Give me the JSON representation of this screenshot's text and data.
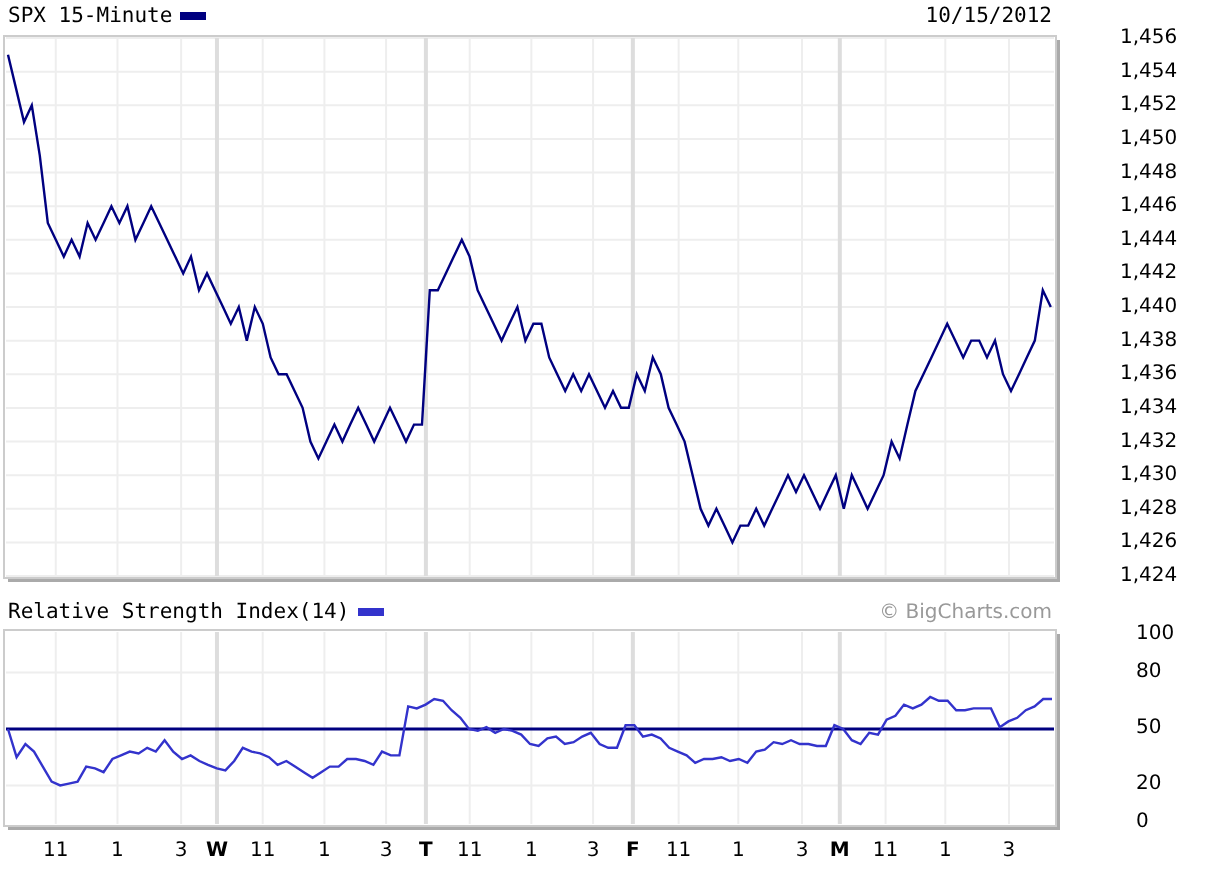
{
  "price_panel": {
    "date": "10/15/2012",
    "chart_data": {
      "type": "line",
      "grid": true,
      "series": [
        {
          "name": "SPX 15-Minute",
          "color": "#000080",
          "values": [
            1455,
            1453,
            1451,
            1452,
            1449,
            1445,
            1444,
            1443,
            1444,
            1443,
            1445,
            1444,
            1445,
            1446,
            1445,
            1446,
            1444,
            1445,
            1446,
            1445,
            1444,
            1443,
            1442,
            1443,
            1441,
            1442,
            1441,
            1440,
            1439,
            1440,
            1438,
            1440,
            1439,
            1437,
            1436,
            1436,
            1435,
            1434,
            1432,
            1431,
            1432,
            1433,
            1432,
            1433,
            1434,
            1433,
            1432,
            1433,
            1434,
            1433,
            1432,
            1433,
            1433,
            1441,
            1441,
            1442,
            1443,
            1444,
            1443,
            1441,
            1440,
            1439,
            1438,
            1439,
            1440,
            1438,
            1439,
            1439,
            1437,
            1436,
            1435,
            1436,
            1435,
            1436,
            1435,
            1434,
            1435,
            1434,
            1434,
            1436,
            1435,
            1437,
            1436,
            1434,
            1433,
            1432,
            1430,
            1428,
            1427,
            1428,
            1427,
            1426,
            1427,
            1427,
            1428,
            1427,
            1428,
            1429,
            1430,
            1429,
            1430,
            1429,
            1428,
            1429,
            1430,
            1428,
            1430,
            1429,
            1428,
            1429,
            1430,
            1432,
            1431,
            1433,
            1435,
            1436,
            1437,
            1438,
            1439,
            1438,
            1437,
            1438,
            1438,
            1437,
            1438,
            1436,
            1435,
            1436,
            1437,
            1438,
            1441,
            1440
          ]
        }
      ],
      "ylim": [
        1424,
        1456
      ],
      "yticks": [
        {
          "value": 1456,
          "label": "1,456"
        },
        {
          "value": 1454,
          "label": "1,454"
        },
        {
          "value": 1452,
          "label": "1,452"
        },
        {
          "value": 1450,
          "label": "1,450"
        },
        {
          "value": 1448,
          "label": "1,448"
        },
        {
          "value": 1446,
          "label": "1,446"
        },
        {
          "value": 1444,
          "label": "1,444"
        },
        {
          "value": 1442,
          "label": "1,442"
        },
        {
          "value": 1440,
          "label": "1,440"
        },
        {
          "value": 1438,
          "label": "1,438"
        },
        {
          "value": 1436,
          "label": "1,436"
        },
        {
          "value": 1434,
          "label": "1,434"
        },
        {
          "value": 1432,
          "label": "1,432"
        },
        {
          "value": 1430,
          "label": "1,430"
        },
        {
          "value": 1428,
          "label": "1,428"
        },
        {
          "value": 1426,
          "label": "1,426"
        },
        {
          "value": 1424,
          "label": "1,424"
        }
      ]
    }
  },
  "rsi_panel": {
    "credit": "© BigCharts.com",
    "chart_data": {
      "type": "line",
      "grid": true,
      "series": [
        {
          "name": "Relative Strength Index(14)",
          "color": "#3333cc",
          "values": [
            50,
            35,
            42,
            38,
            30,
            22,
            20,
            21,
            22,
            30,
            29,
            27,
            34,
            36,
            38,
            37,
            40,
            38,
            44,
            38,
            34,
            36,
            33,
            31,
            29,
            28,
            33,
            40,
            38,
            37,
            35,
            31,
            33,
            30,
            27,
            24,
            27,
            30,
            30,
            34,
            34,
            33,
            31,
            38,
            36,
            36,
            62,
            61,
            63,
            66,
            65,
            60,
            56,
            50,
            49,
            51,
            48,
            50,
            49,
            47,
            42,
            41,
            45,
            46,
            42,
            43,
            46,
            48,
            42,
            40,
            40,
            52,
            52,
            46,
            47,
            45,
            40,
            38,
            36,
            32,
            34,
            34,
            35,
            33,
            34,
            32,
            38,
            39,
            43,
            42,
            44,
            42,
            42,
            41,
            41,
            52,
            50,
            44,
            42,
            48,
            47,
            55,
            57,
            63,
            61,
            63,
            67,
            65,
            65,
            60,
            60,
            61,
            61,
            61,
            51,
            54,
            56,
            60,
            62,
            66,
            66
          ]
        }
      ],
      "ylim": [
        0,
        100
      ],
      "yticks": [
        0,
        20,
        50,
        80,
        100
      ],
      "ref_lines": [
        {
          "axis": "y",
          "value": 50
        }
      ]
    },
    "time_labels": [
      {
        "text": "11",
        "day": false
      },
      {
        "text": "1",
        "day": false
      },
      {
        "text": "3",
        "day": false
      },
      {
        "text": "W",
        "day": true
      },
      {
        "text": "11",
        "day": false
      },
      {
        "text": "1",
        "day": false
      },
      {
        "text": "3",
        "day": false
      },
      {
        "text": "T",
        "day": true
      },
      {
        "text": "11",
        "day": false
      },
      {
        "text": "1",
        "day": false
      },
      {
        "text": "3",
        "day": false
      },
      {
        "text": "F",
        "day": true
      },
      {
        "text": "11",
        "day": false
      },
      {
        "text": "1",
        "day": false
      },
      {
        "text": "3",
        "day": false
      },
      {
        "text": "M",
        "day": true
      },
      {
        "text": "11",
        "day": false
      },
      {
        "text": "1",
        "day": false
      },
      {
        "text": "3",
        "day": false
      }
    ]
  }
}
